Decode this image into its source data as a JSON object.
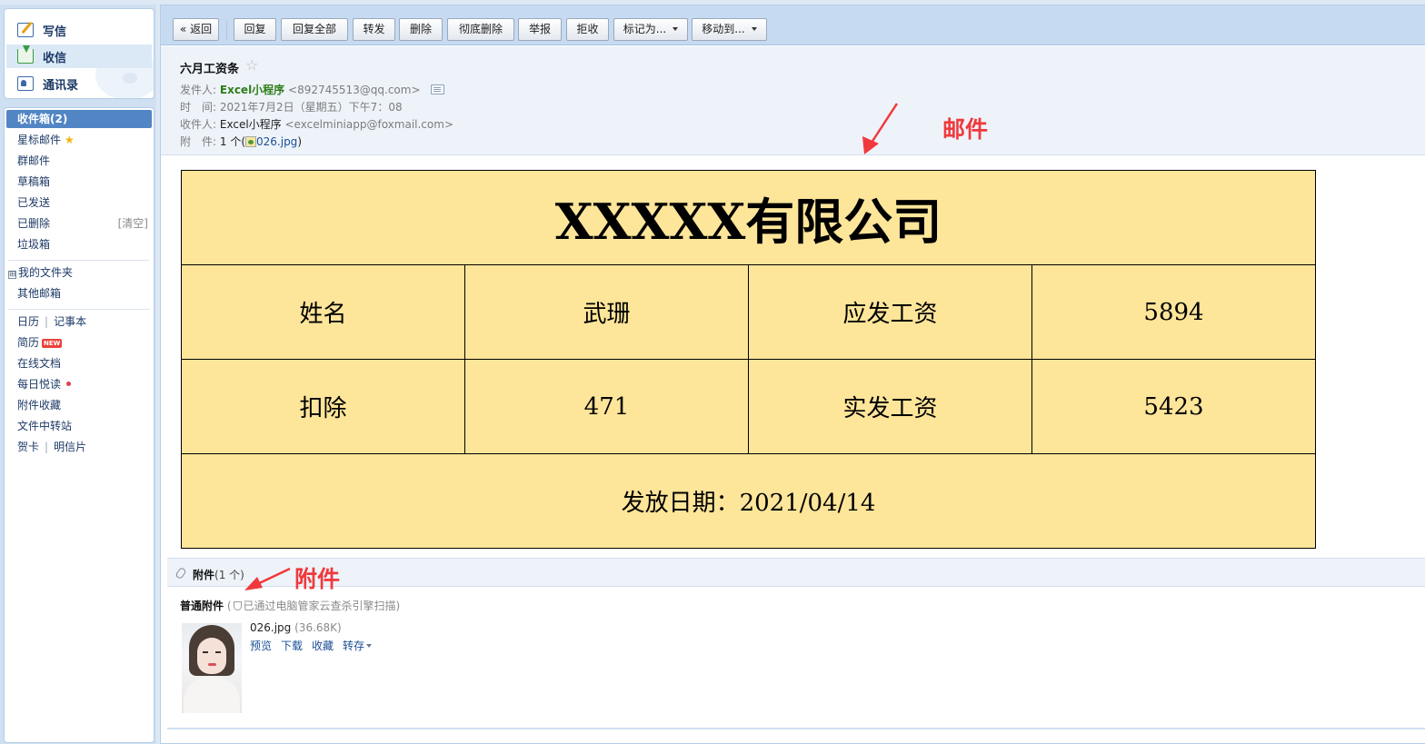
{
  "sidebar": {
    "quick": [
      {
        "label": "写信",
        "icon": "compose-icon"
      },
      {
        "label": "收信",
        "icon": "inbox-download-icon"
      },
      {
        "label": "通讯录",
        "icon": "contacts-icon"
      }
    ],
    "folders": {
      "inbox": "收件箱(2)",
      "starred": "星标邮件",
      "group": "群邮件",
      "drafts": "草稿箱",
      "sent": "已发送",
      "deleted": "已删除",
      "clear": "[清空]",
      "spam": "垃圾箱",
      "my_folders_plus": "⊞",
      "my_folders": "我的文件夹",
      "other": "其他邮箱",
      "calendar": "日历",
      "notepad": "记事本",
      "resume": "简历",
      "resume_badge": "NEW",
      "docs": "在线文档",
      "daily": "每日悦读",
      "fav_att": "附件收藏",
      "transfer": "文件中转站",
      "card": "贺卡",
      "postcard": "明信片",
      "separator": "|"
    }
  },
  "toolbar": {
    "back": "« 返回",
    "reply": "回复",
    "reply_all": "回复全部",
    "forward": "转发",
    "delete": "删除",
    "delete_perm": "彻底删除",
    "report": "举报",
    "reject": "拒收",
    "mark_as": "标记为...",
    "move_to": "移动到..."
  },
  "mail": {
    "subject": "六月工资条",
    "star": "☆",
    "from_label": "发件人:",
    "from_name": "Excel小程序",
    "from_email": "<892745513@qq.com>",
    "time_label": "时　间:",
    "time": "2021年7月2日（星期五）下午7：08",
    "to_label": "收件人:",
    "to_name": "Excel小程序",
    "to_email": "<excelminiapp@foxmail.com>",
    "att_label": "附　件:",
    "att_count": "1 个",
    "att_open": "(",
    "att_file": "026.jpg",
    "att_close": ")"
  },
  "annotations": {
    "mail": "邮件",
    "attachment": "附件"
  },
  "payslip": {
    "company": "XXXXX有限公司",
    "name_label": "姓名",
    "name": "武珊",
    "gross_label": "应发工资",
    "gross": "5894",
    "deduct_label": "扣除",
    "deduct": "471",
    "net_label": "实发工资",
    "net": "5423",
    "date_line": "发放日期：2021/04/14"
  },
  "attachments": {
    "title": "附件",
    "count": "(1 个)",
    "normal_title": "普通附件",
    "scan_open": "(",
    "scan_note": "已通过电脑管家云查杀引擎扫描",
    "scan_close": ")",
    "file_name": "026.jpg",
    "file_size": "(36.68K)",
    "actions": [
      "预览",
      "下载",
      "收藏",
      "转存"
    ]
  },
  "colors": {
    "accent": "#5185c4",
    "toolbar_bg": "#c6dbf1",
    "payslip_bg": "#fde59a",
    "annotation": "#f0393c",
    "sender_green": "#2e7d18"
  }
}
